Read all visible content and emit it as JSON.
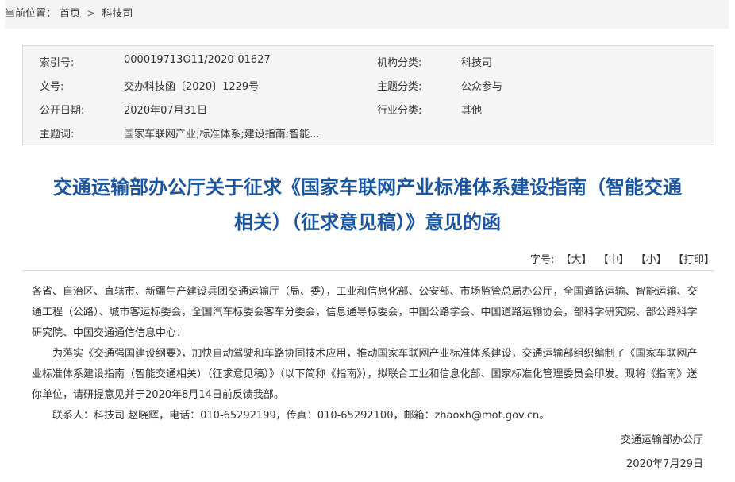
{
  "breadcrumb": {
    "label": "当前位置：",
    "items": [
      "首页",
      "科技司"
    ],
    "separator": ">"
  },
  "meta": {
    "index_no_label": "索引号:",
    "index_no": "000019713O11/2020-01627",
    "org_label": "机构分类:",
    "org": "科技司",
    "doc_no_label": "文号:",
    "doc_no": "交办科技函〔2020〕1229号",
    "topic_label": "主题分类:",
    "topic": "公众参与",
    "date_label": "公开日期:",
    "date": "2020年07月31日",
    "industry_label": "行业分类:",
    "industry": "其他",
    "keywords_label": "主题词:",
    "keywords": "国家车联网产业;标准体系;建设指南;智能..."
  },
  "title": {
    "line1": "交通运输部办公厅关于征求《国家车联网产业标准体系建设指南（智能交通",
    "line2": "相关）（征求意见稿）》意见的函"
  },
  "font_controls": {
    "label": "字号:",
    "large": "【大】",
    "medium": "【中】",
    "small": "【小】",
    "print": "【打印】"
  },
  "body": {
    "p1": "各省、自治区、直辖市、新疆生产建设兵团交通运输厅（局、委），工业和信息化部、公安部、市场监管总局办公厅，全国道路运输、智能运输、交通工程（公路）、城市客运标委会，全国汽车标委会客车分委会，信息通导标委会，中国公路学会、中国道路运输协会，部科学研究院、部公路科学研究院、中国交通通信信息中心：",
    "p2": "为落实《交通强国建设纲要》，加快自动驾驶和车路协同技术应用，推动国家车联网产业标准体系建设，交通运输部组织编制了《国家车联网产业标准体系建设指南（智能交通相关）（征求意见稿）》（以下简称《指南》），拟联合工业和信息化部、国家标准化管理委员会印发。现将《指南》送你单位，请研提意见并于2020年8月14日前反馈我部。",
    "p3": "联系人：科技司 赵晓辉，电话：010-65292199，传真：010-65292100，邮箱：zhaoxh@mot.gov.cn。"
  },
  "signature": {
    "org": "交通运输部办公厅",
    "date": "2020年7月29日"
  }
}
